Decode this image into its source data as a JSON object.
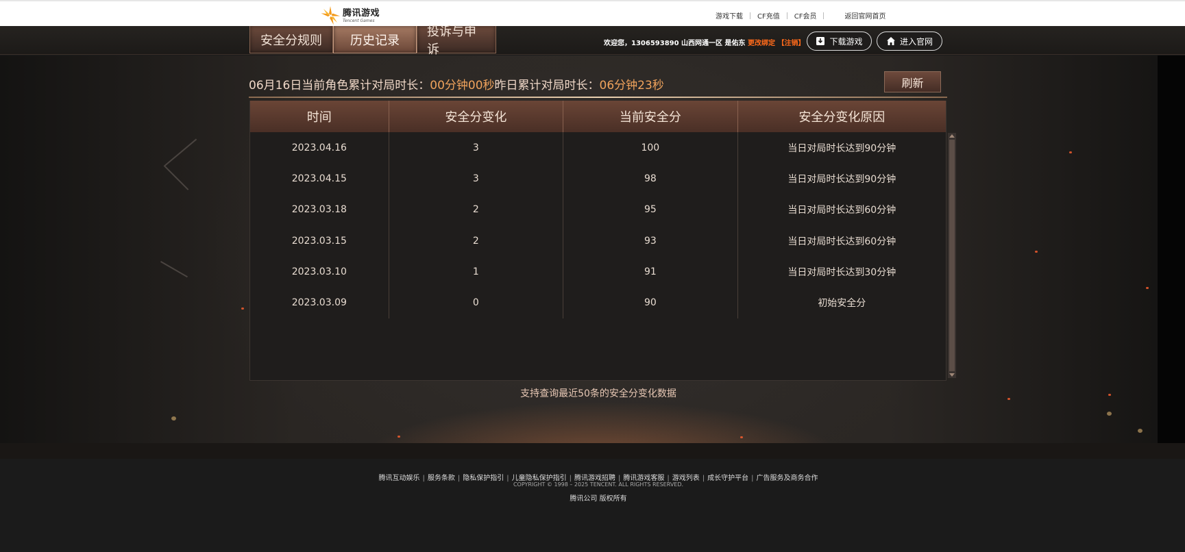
{
  "topbar": {
    "logo_cn": "腾讯游戏",
    "logo_en": "Tencent Games",
    "links": [
      "游戏下载",
      "CF充值",
      "CF会员",
      "返回官网首页"
    ]
  },
  "nav": {
    "tabs": [
      {
        "label": "安全分规则",
        "active": false
      },
      {
        "label": "历史记录",
        "active": true
      },
      {
        "label": "投诉与申诉",
        "active": false
      }
    ],
    "welcome": "欢迎您，1306593890 山西网通一区 是佑东",
    "change_bind": "更改绑定",
    "logout": "【注销】",
    "download_label": "下载游戏",
    "home_label": "进入官网"
  },
  "summary": {
    "date_prefix": "06月16日当前角色累计对局时长：",
    "today_duration": "00分钟00秒",
    "yesterday_prefix": "昨日累计对局时长：",
    "yesterday_duration": "06分钟23秒",
    "refresh_label": "刷新"
  },
  "table": {
    "headers": [
      "时间",
      "安全分变化",
      "当前安全分",
      "安全分变化原因"
    ],
    "rows": [
      [
        "2023.04.16",
        "3",
        "100",
        "当日对局时长达到90分钟"
      ],
      [
        "2023.04.15",
        "3",
        "98",
        "当日对局时长达到90分钟"
      ],
      [
        "2023.03.18",
        "2",
        "95",
        "当日对局时长达到60分钟"
      ],
      [
        "2023.03.15",
        "2",
        "93",
        "当日对局时长达到60分钟"
      ],
      [
        "2023.03.10",
        "1",
        "91",
        "当日对局时长达到30分钟"
      ],
      [
        "2023.03.09",
        "0",
        "90",
        "初始安全分"
      ]
    ]
  },
  "note": "支持查询最近50条的安全分变化数据",
  "footer": {
    "links": [
      "腾讯互动娱乐",
      "服务条款",
      "隐私保护指引",
      "儿童隐私保护指引",
      "腾讯游戏招聘",
      "腾讯游戏客服",
      "游戏列表",
      "成长守护平台",
      "广告服务及商务合作"
    ],
    "copyright": "COPYRIGHT © 1998 – 2025 TENCENT. ALL RIGHTS RESERVED.",
    "rights": "腾讯公司 版权所有"
  },
  "colors": {
    "accent_orange": "#f0a35c",
    "link_orange": "#ff6a1a",
    "tab_active": "#a57a63",
    "header_brown": "#6a4536"
  }
}
